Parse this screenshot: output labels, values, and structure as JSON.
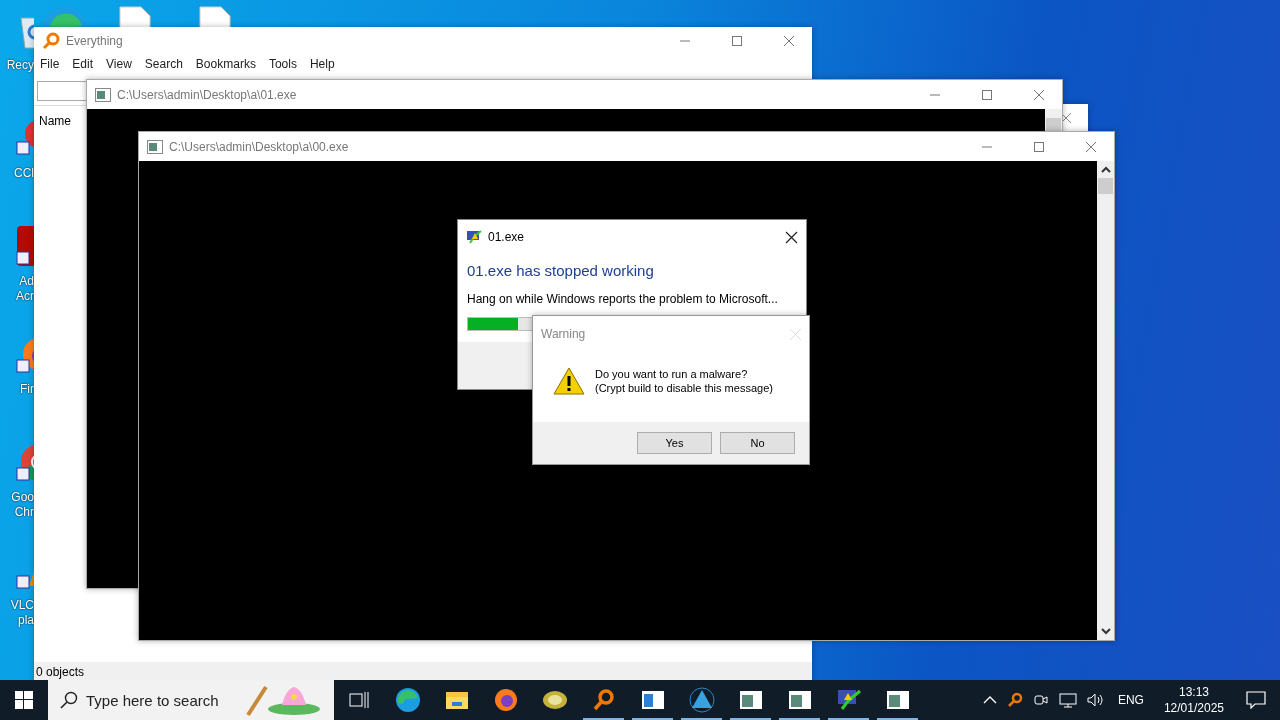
{
  "desktop_top_icons": [
    {
      "kind": "edge"
    },
    {
      "kind": "file"
    },
    {
      "kind": "file"
    }
  ],
  "desktop_icons": [
    {
      "kind": "recycle",
      "label": [
        "Recy"
      ]
    },
    {
      "kind": "ccleaner",
      "label": [
        "CCl"
      ]
    },
    {
      "kind": "acrobat",
      "label": [
        "Ad",
        "Acr"
      ]
    },
    {
      "kind": "firefox",
      "label": [
        "Fir"
      ]
    },
    {
      "kind": "chrome",
      "label": [
        "Goo",
        "Chr"
      ]
    },
    {
      "kind": "vlc",
      "label": [
        "VLC",
        "pla"
      ]
    }
  ],
  "everything_window": {
    "title": "Everything",
    "menu": [
      "File",
      "Edit",
      "View",
      "Search",
      "Bookmarks",
      "Tools",
      "Help"
    ],
    "column": "Name",
    "status": "0 objects"
  },
  "console_windows": [
    {
      "title": "C:\\Users\\admin\\Desktop\\a\\01.exe"
    },
    {
      "title": "C:\\Users\\admin\\Desktop\\a\\00.exe"
    }
  ],
  "error_dialog": {
    "title": "01.exe",
    "heading": "01.exe has stopped working",
    "message": "Hang on while Windows reports the problem to Microsoft...",
    "level": 0.15
  },
  "warning_dialog": {
    "title": "Warning",
    "lines": [
      "Do you want to run a malware?",
      "(Crypt build to disable this message)"
    ],
    "buttons": [
      "Yes",
      "No"
    ]
  },
  "taskbar": {
    "placeholder": "Type here to search",
    "apps": [
      {
        "kind": "edge",
        "running": false
      },
      {
        "kind": "folder",
        "running": false
      },
      {
        "kind": "firefox",
        "running": false
      },
      {
        "kind": "kiwi",
        "running": false
      },
      {
        "kind": "everything",
        "running": true
      },
      {
        "kind": "window",
        "running": true
      },
      {
        "kind": "triangle",
        "running": true
      },
      {
        "kind": "console",
        "running": true
      },
      {
        "kind": "console",
        "running": true
      },
      {
        "kind": "warning",
        "running": true
      },
      {
        "kind": "console",
        "running": true
      }
    ],
    "language": "ENG",
    "time": "13:13",
    "date": "12/01/2025"
  }
}
